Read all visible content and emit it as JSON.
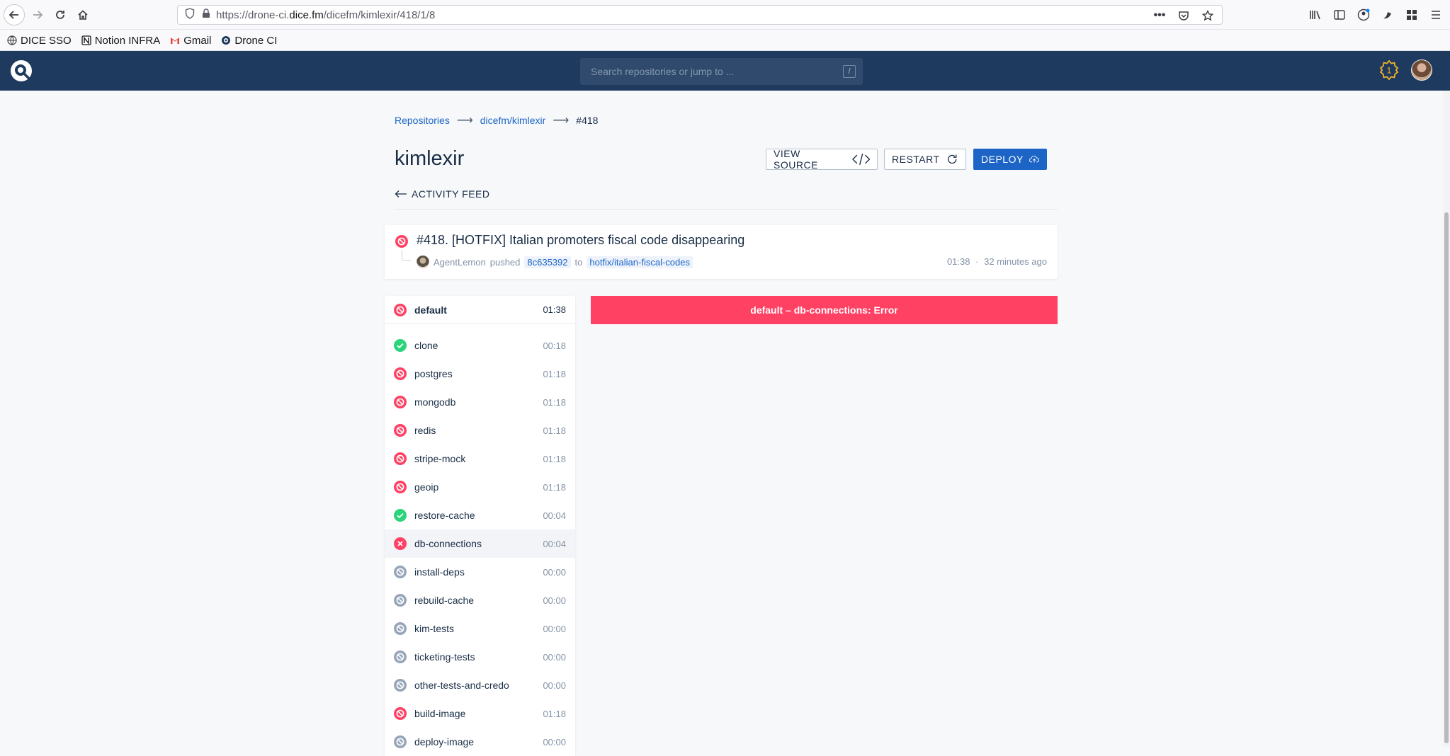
{
  "browser": {
    "url_prefix": "https://drone-ci.",
    "url_domain": "dice.fm",
    "url_path": "/dicefm/kimlexir/418/1/8",
    "bookmarks": [
      {
        "label": "DICE SSO",
        "icon": "globe-icon"
      },
      {
        "label": "Notion INFRA",
        "icon": "notion-icon"
      },
      {
        "label": "Gmail",
        "icon": "gmail-icon"
      },
      {
        "label": "Drone CI",
        "icon": "drone-icon"
      }
    ]
  },
  "header": {
    "search_placeholder": "Search repositories or jump to ...",
    "search_shortcut": "/",
    "notification_count": "1"
  },
  "breadcrumb": {
    "repositories": "Repositories",
    "repo": "dicefm/kimlexir",
    "build": "#418",
    "separator": "⟶"
  },
  "page": {
    "title": "kimlexir",
    "view_source_label": "VIEW SOURCE",
    "restart_label": "RESTART",
    "deploy_label": "DEPLOY",
    "activity_feed_label": "ACTIVITY FEED"
  },
  "build": {
    "title": "#418. [HOTFIX] Italian promoters fiscal code disappearing",
    "author": "AgentLemon",
    "action": "pushed",
    "commit": "8c635392",
    "to": "to",
    "branch": "hotfix/italian-fiscal-codes",
    "duration": "01:38",
    "dot": "·",
    "ago": "32 minutes ago",
    "status": "blocked"
  },
  "stage": {
    "name": "default",
    "time": "01:38",
    "status": "blocked",
    "steps": [
      {
        "name": "clone",
        "time": "00:18",
        "status": "success"
      },
      {
        "name": "postgres",
        "time": "01:18",
        "status": "blocked"
      },
      {
        "name": "mongodb",
        "time": "01:18",
        "status": "blocked"
      },
      {
        "name": "redis",
        "time": "01:18",
        "status": "blocked"
      },
      {
        "name": "stripe-mock",
        "time": "01:18",
        "status": "blocked"
      },
      {
        "name": "geoip",
        "time": "01:18",
        "status": "blocked"
      },
      {
        "name": "restore-cache",
        "time": "00:04",
        "status": "success"
      },
      {
        "name": "db-connections",
        "time": "00:04",
        "status": "error",
        "active": true
      },
      {
        "name": "install-deps",
        "time": "00:00",
        "status": "skipped"
      },
      {
        "name": "rebuild-cache",
        "time": "00:00",
        "status": "skipped"
      },
      {
        "name": "kim-tests",
        "time": "00:00",
        "status": "skipped"
      },
      {
        "name": "ticketing-tests",
        "time": "00:00",
        "status": "skipped"
      },
      {
        "name": "other-tests-and-credo",
        "time": "00:00",
        "status": "skipped"
      },
      {
        "name": "build-image",
        "time": "01:18",
        "status": "blocked"
      },
      {
        "name": "deploy-image",
        "time": "00:00",
        "status": "skipped"
      }
    ]
  },
  "error_banner": "default – db-connections: Error",
  "colors": {
    "header_bg": "#1f3a5f",
    "link": "#1c65c7",
    "error": "#ff4164",
    "success": "#2bd47a",
    "skipped": "#96a5b8"
  }
}
